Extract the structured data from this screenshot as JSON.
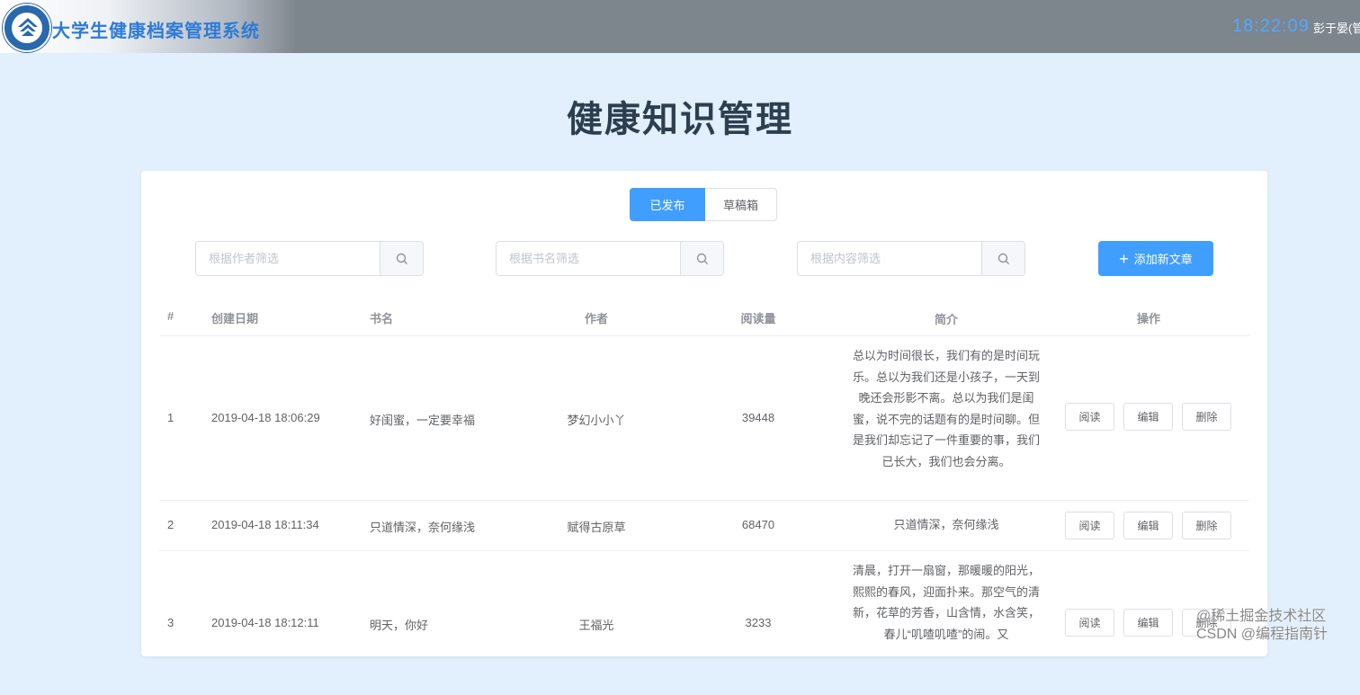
{
  "header": {
    "app_title": "大学生健康档案管理系统",
    "clock": "18:22:09",
    "user": "彭于晏(管"
  },
  "page": {
    "title": "健康知识管理"
  },
  "tabs": [
    {
      "label": "已发布",
      "active": true
    },
    {
      "label": "草稿箱",
      "active": false
    }
  ],
  "filters": [
    {
      "placeholder": "根据作者筛选"
    },
    {
      "placeholder": "根据书名筛选"
    },
    {
      "placeholder": "根据内容筛选"
    }
  ],
  "add_button": {
    "label": "添加新文章"
  },
  "table": {
    "headers": [
      "#",
      "创建日期",
      "书名",
      "作者",
      "阅读量",
      "简介",
      "操作"
    ],
    "rows": [
      {
        "idx": "1",
        "date": "2019-04-18 18:06:29",
        "book": "好闺蜜，一定要幸福",
        "author": "梦幻小小丫",
        "reads": "39448",
        "intro": "总以为时间很长，我们有的是时间玩乐。总以为我们还是小孩子，一天到晚还会形影不离。总以为我们是闺蜜，说不完的话题有的是时间聊。但是我们却忘记了一件重要的事，我们已长大，我们也会分离。"
      },
      {
        "idx": "2",
        "date": "2019-04-18 18:11:34",
        "book": "只道情深，奈何缘浅",
        "author": "赋得古原草",
        "reads": "68470",
        "intro": "只道情深，奈何缘浅"
      },
      {
        "idx": "3",
        "date": "2019-04-18 18:12:11",
        "book": "明天，你好",
        "author": "王福光",
        "reads": "3233",
        "intro": "清晨，打开一扇窗，那暖暖的阳光，熙熙的春风，迎面扑来。那空气的清新，花草的芳香，山含情，水含笑，春儿“叽喳叽喳”的闹。又"
      }
    ],
    "ops": [
      "阅读",
      "编辑",
      "删除"
    ]
  },
  "watermark": "@稀土掘金技术社区\nCSDN @编程指南针"
}
